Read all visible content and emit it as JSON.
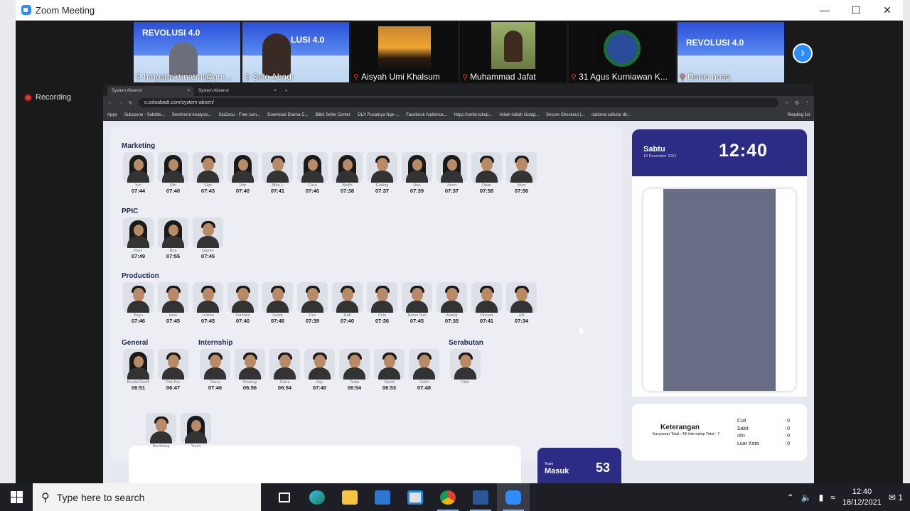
{
  "zoom": {
    "title": "Zoom Meeting",
    "recording": "Recording",
    "participants": [
      {
        "name": "hmpstmirtmatmi@gm...",
        "muted": false
      },
      {
        "name": "Solo Abadi",
        "muted": false
      },
      {
        "name": "Aisyah Umi Khalsum",
        "muted": true
      },
      {
        "name": "Muhammad Jafat",
        "muted": true
      },
      {
        "name": "31 Agus Kurniawan K...",
        "muted": true
      },
      {
        "name": "Danis nusa",
        "muted": true
      }
    ],
    "banner_text": "REVOLUSI 4.0"
  },
  "browser": {
    "tabs": [
      "System Absensi",
      "System Absensi"
    ],
    "url": "s.soloabadi.com/system-absen/",
    "bookmarks": [
      "Apps",
      "Subscene - Subtitle...",
      "Sentiment Analysis...",
      "StuDocu - Free sum...",
      "Download Drama C...",
      "Blibli Seller Center",
      "OLX Pusatnya Nge-...",
      "Facebook Audience...",
      "https://seller.tokop...",
      "Istilah-istilah Googl...",
      "Secure Checkout |...",
      "national cellular dir..."
    ],
    "reading_list": "Reading list"
  },
  "absensi": {
    "marketing": {
      "title": "Marketing",
      "employees": [
        {
          "name": "Yuri",
          "time": "07:44"
        },
        {
          "name": "Ulin",
          "time": "07:40"
        },
        {
          "name": "Sigit",
          "time": "07:43"
        },
        {
          "name": "Umi",
          "time": "07:40"
        },
        {
          "name": "Mba L",
          "time": "07:41"
        },
        {
          "name": "Caca",
          "time": "07:40"
        },
        {
          "name": "Berlin",
          "time": "07:38"
        },
        {
          "name": "Gading",
          "time": "07:37"
        },
        {
          "name": "Ane",
          "time": "07:39"
        },
        {
          "name": "Arum",
          "time": "07:37"
        },
        {
          "name": "Opan",
          "time": "07:58"
        },
        {
          "name": "Ildan",
          "time": "07:56"
        }
      ]
    },
    "ppic": {
      "title": "PPIC",
      "employees": [
        {
          "name": "Rani",
          "time": "07:49"
        },
        {
          "name": "Rira",
          "time": "07:55"
        },
        {
          "name": "Gianto",
          "time": "07:45"
        }
      ]
    },
    "production": {
      "title": "Production",
      "employees": [
        {
          "name": "Bayu",
          "time": "07:46"
        },
        {
          "name": "Iwan",
          "time": "07:45"
        },
        {
          "name": "Lukma",
          "time": "07:45"
        },
        {
          "name": "Konthus",
          "time": "07:40"
        },
        {
          "name": "Sudar",
          "time": "07:46"
        },
        {
          "name": "Dwi",
          "time": "07:39"
        },
        {
          "name": "Rafi",
          "time": "07:40"
        },
        {
          "name": "Polo",
          "time": "07:36"
        },
        {
          "name": "Narso Sun",
          "time": "07:45"
        },
        {
          "name": "Anang",
          "time": "07:35"
        },
        {
          "name": "Vincent",
          "time": "07:41"
        },
        {
          "name": "Alif",
          "time": "07:34"
        }
      ]
    },
    "general": {
      "title": "General",
      "employees": [
        {
          "name": "Bunda Danik",
          "time": "06:51"
        },
        {
          "name": "Pak Par",
          "time": "06:47"
        }
      ]
    },
    "internship": {
      "title": "Internship",
      "employees": [
        {
          "name": "Rana",
          "time": "07:46"
        },
        {
          "name": "Bintang",
          "time": "06:56"
        },
        {
          "name": "Cisha",
          "time": "06:54"
        },
        {
          "name": "Juju",
          "time": "07:40"
        },
        {
          "name": "Tema",
          "time": "06:54"
        },
        {
          "name": "David",
          "time": "06:53"
        },
        {
          "name": "Galih",
          "time": "07:48"
        }
      ]
    },
    "serabutan": {
      "title": "Serabutan",
      "employees": [
        {
          "name": "Dian",
          "time": ""
        }
      ]
    },
    "bottom": [
      {
        "name": "Bambang"
      },
      {
        "name": "Yunin"
      }
    ],
    "team": {
      "label1": "Team",
      "label2": "Masuk",
      "count": "53"
    },
    "clock": {
      "day": "Sabtu",
      "date": "18 Desember 2021",
      "time": "12:40"
    },
    "keterangan": {
      "title": "Keterangan",
      "summary": "Karyawan Total : 48 Internship Total : 7",
      "items": [
        {
          "label": "Cuti",
          "value": ": 0"
        },
        {
          "label": "Sakit",
          "value": ": 0"
        },
        {
          "label": "Izin",
          "value": ": 0"
        },
        {
          "label": "Luar Kota",
          "value": ": 0"
        }
      ]
    }
  },
  "taskbar": {
    "search_placeholder": "Type here to search",
    "time": "12:40",
    "date": "18/12/2021",
    "notif_count": "1"
  }
}
